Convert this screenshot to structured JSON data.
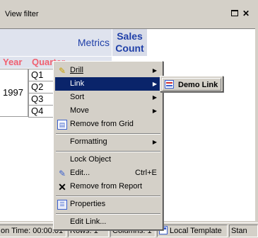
{
  "panel": {
    "title": "View filter"
  },
  "grid": {
    "metrics_label": "Metrics",
    "metric_header": "Sales\nCount",
    "row_headers": [
      "Year",
      "Quarter"
    ],
    "year": "1997",
    "quarters": [
      "Q1",
      "Q2",
      "Q3",
      "Q4"
    ]
  },
  "context_menu": {
    "items": [
      {
        "label": "Drill",
        "has_submenu": true,
        "icon": "drill-icon"
      },
      {
        "label": "Link",
        "has_submenu": true,
        "highlighted": true
      },
      {
        "label": "Sort",
        "has_submenu": true
      },
      {
        "label": "Move",
        "has_submenu": true
      },
      {
        "label": "Remove from Grid",
        "icon": "remove-grid-icon"
      },
      {
        "label": "Formatting",
        "has_submenu": true
      },
      {
        "label": "Lock Object"
      },
      {
        "label": "Edit...",
        "shortcut": "Ctrl+E",
        "icon": "edit-icon"
      },
      {
        "label": "Remove from Report",
        "icon": "delete-x-icon"
      },
      {
        "label": "Properties",
        "icon": "properties-icon"
      },
      {
        "label": "Edit Link..."
      }
    ]
  },
  "submenu": {
    "item": "Demo Link",
    "icon": "link-icon"
  },
  "status_bar": {
    "time": "on Time: 00:00:01",
    "rows": "Rows: 1",
    "columns": "Columns: 1",
    "template": "Local Template",
    "mode": "Stan"
  },
  "colors": {
    "highlight": "#0a246a",
    "header_text": "#1f3fa8",
    "row_header_text": "#f06070"
  }
}
